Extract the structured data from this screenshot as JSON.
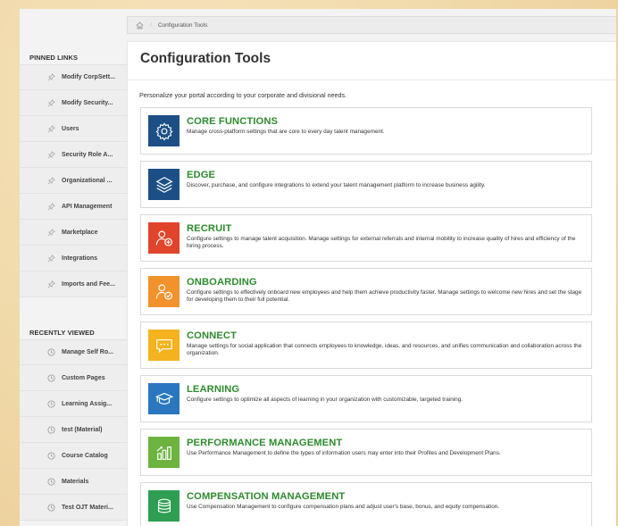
{
  "breadcrumb": {
    "home_icon": "home-icon",
    "current": "Configuration Tools"
  },
  "sidebar": {
    "pinned_heading": "PINNED LINKS",
    "pinned": [
      {
        "label": "Modify CorpSett...",
        "icon": "pin-icon"
      },
      {
        "label": "Modify Security...",
        "icon": "pin-icon"
      },
      {
        "label": "Users",
        "icon": "pin-icon"
      },
      {
        "label": "Security Role A...",
        "icon": "pin-icon"
      },
      {
        "label": "Organizational ...",
        "icon": "pin-icon"
      },
      {
        "label": "API Management",
        "icon": "pin-icon"
      },
      {
        "label": "Marketplace",
        "icon": "pin-icon"
      },
      {
        "label": "Integrations",
        "icon": "pin-icon"
      },
      {
        "label": "Imports and Fee...",
        "icon": "pin-icon"
      }
    ],
    "recent_heading": "RECENTLY VIEWED",
    "recent": [
      {
        "label": "Manage Self Ro...",
        "icon": "clock-icon"
      },
      {
        "label": "Custom Pages",
        "icon": "clock-icon"
      },
      {
        "label": "Learning Assig...",
        "icon": "clock-icon"
      },
      {
        "label": "test (Material)",
        "icon": "clock-icon"
      },
      {
        "label": "Course Catalog",
        "icon": "clock-icon"
      },
      {
        "label": "Materials",
        "icon": "clock-icon"
      },
      {
        "label": "Test OJT Materi...",
        "icon": "clock-icon"
      }
    ]
  },
  "main": {
    "title": "Configuration Tools",
    "intro": "Personalize your portal according to your corporate and divisional needs.",
    "cards": [
      {
        "title": "CORE FUNCTIONS",
        "desc": "Manage cross-platform settings that are core to every day talent management.",
        "icon": "gear-icon",
        "color": "#1c4f86"
      },
      {
        "title": "EDGE",
        "desc": "Discover, purchase, and configure integrations to extend your talent management platform to increase business agility.",
        "icon": "layers-icon",
        "color": "#1c4f86"
      },
      {
        "title": "RECRUIT",
        "desc": "Configure settings to manage talent acquisition. Manage settings for external referrals and internal mobility to increase quality of hires and efficiency of the hiring process.",
        "icon": "add-person-icon",
        "color": "#e0442b"
      },
      {
        "title": "ONBOARDING",
        "desc": "Configure settings to effectively onboard new employees and help them achieve productivity faster. Manage settings to welcome new hires and set the stage for developing them to their full potential.",
        "icon": "person-check-icon",
        "color": "#f2922c"
      },
      {
        "title": "CONNECT",
        "desc": "Manage settings for social application that connects employees to knowledge, ideas, and resources, and unifies communication and collaboration across the organization.",
        "icon": "chat-icon",
        "color": "#f4b31f"
      },
      {
        "title": "LEARNING",
        "desc": "Configure settings to optimize all aspects of learning in your organization with customizable, targeted training.",
        "icon": "graduation-cap-icon",
        "color": "#2a77bf"
      },
      {
        "title": "PERFORMANCE MANAGEMENT",
        "desc": "Use Performance Management to define the  types of information users may enter into their Profiles and Development Plans.",
        "icon": "bar-chart-icon",
        "color": "#6db33f"
      },
      {
        "title": "COMPENSATION MANAGEMENT",
        "desc": "Use Compensation Management to configure compensation plans and adjust user's base, bonus, and equity compensation.",
        "icon": "coins-icon",
        "color": "#2e9e53"
      }
    ]
  }
}
